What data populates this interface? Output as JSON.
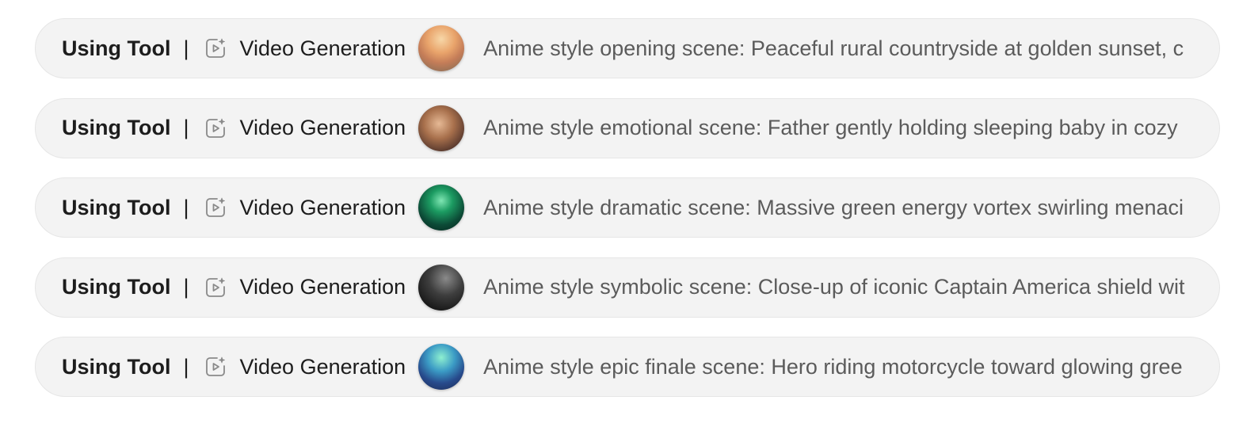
{
  "rows": [
    {
      "status_label": "Using Tool",
      "separator": "|",
      "tool_icon": "video-generation-icon",
      "tool_name": "Video Generation",
      "thumbnail": "sunset-countryside-thumbnail",
      "prompt": "Anime style opening scene: Peaceful rural countryside at golden sunset, c"
    },
    {
      "status_label": "Using Tool",
      "separator": "|",
      "tool_icon": "video-generation-icon",
      "tool_name": "Video Generation",
      "thumbnail": "father-baby-thumbnail",
      "prompt": "Anime style emotional scene: Father gently holding sleeping baby in cozy"
    },
    {
      "status_label": "Using Tool",
      "separator": "|",
      "tool_icon": "video-generation-icon",
      "tool_name": "Video Generation",
      "thumbnail": "green-vortex-thumbnail",
      "prompt": "Anime style dramatic scene: Massive green energy vortex swirling menaci"
    },
    {
      "status_label": "Using Tool",
      "separator": "|",
      "tool_icon": "video-generation-icon",
      "tool_name": "Video Generation",
      "thumbnail": "shield-closeup-thumbnail",
      "prompt": "Anime style symbolic scene: Close-up of iconic Captain America shield wit"
    },
    {
      "status_label": "Using Tool",
      "separator": "|",
      "tool_icon": "video-generation-icon",
      "tool_name": "Video Generation",
      "thumbnail": "aurora-motorcycle-thumbnail",
      "prompt": "Anime style epic finale scene: Hero riding motorcycle toward glowing gree"
    }
  ]
}
